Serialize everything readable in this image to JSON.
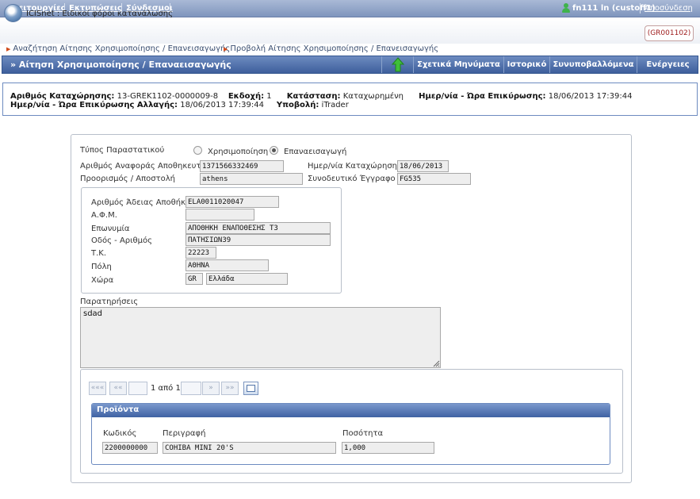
{
  "topbar": {
    "menu": [
      "Λειτουργίες",
      "Εκτυπώσεις",
      "Σύνδεσμοι"
    ],
    "user": "fn111 ln (custoff1)",
    "logout": "Αποσύνδεση"
  },
  "app": {
    "title": "ICISnet : Ειδικοί φόροι κατανάλωσης",
    "badge": "(GR001102)"
  },
  "breadcrumb": [
    "Αναζήτηση Αίτησης Χρησιμοποίησης / Επανεισαγωγής",
    "Προβολή Αίτησης Χρησιμοποίησης / Επανεισαγωγής"
  ],
  "actionbar": {
    "title": "» Αίτηση Χρησιμοποίησης / Επαναεισαγωγής",
    "buttons": [
      "Σχετικά Μηνύματα",
      "Ιστορικό",
      "Συνυποβαλλόμενα",
      "Ενέργειες"
    ]
  },
  "info": {
    "reg_no_label": "Αριθμός Καταχώρησης:",
    "reg_no": "13-GREK1102-0000009-8",
    "version_label": "Εκδοχή:",
    "version": "1",
    "status_label": "Κατάσταση:",
    "status": "Καταχωρημένη",
    "confirm_date_label": "Ημερ/νία - Ώρα Επικύρωσης:",
    "confirm_date": "18/06/2013 17:39:44",
    "change_date_label": "Ημερ/νία - Ώρα Επικύρωσης Αλλαγής:",
    "change_date": "18/06/2013 17:39:44",
    "submission_label": "Υποβολή:",
    "submission": "iTrader"
  },
  "form": {
    "doc_type_label": "Τύπος Παραστατικού",
    "doc_type_options": [
      "Χρησιμοποίηση",
      "Επαναεισαγωγή"
    ],
    "doc_type_selected": "Επαναεισαγωγή",
    "ref_no_label": "Αριθμός Αναφοράς Αποθηκευτή",
    "ref_no": "1371566332469",
    "reg_date_label": "Ημερ/νία Καταχώρησης",
    "reg_date": "18/06/2013",
    "destination_label": "Προορισμός / Αποστολή",
    "destination": "athens",
    "accompanying_label": "Συνοδευτικό Έγγραφο",
    "accompanying": "FG535",
    "warehouse": {
      "license_label": "Αριθμός Άδειας Αποθήκης",
      "license": "ELA0011020047",
      "afm_label": "Α.Φ.Μ.",
      "afm": "",
      "name_label": "Επωνυμία",
      "name": "ΑΠΟΘΗΚΗ ΕΝΑΠΟΘΕΣΗΣ Τ3",
      "street_label": "Οδός - Αριθμός",
      "street": "ΠΑΤΗΣΙΩΝ39",
      "postal_label": "Τ.Κ.",
      "postal": "22223",
      "city_label": "Πόλη",
      "city": "ΑΘΗΝΑ",
      "country_label": "Χώρα",
      "country_code": "GR",
      "country_name": "Ελλάδα"
    },
    "notes_label": "Παρατηρήσεις",
    "notes": "sdad"
  },
  "pager": {
    "first": "«««",
    "prev": "««",
    "next": "»",
    "last": "»»",
    "page_text": "1 από 1"
  },
  "products": {
    "title": "Προϊόντα",
    "code_label": "Κωδικός",
    "desc_label": "Περιγραφή",
    "qty_label": "Ποσότητα",
    "code": "2200000000",
    "desc": "COHIBA MINI 20'S",
    "qty": "1,000"
  }
}
